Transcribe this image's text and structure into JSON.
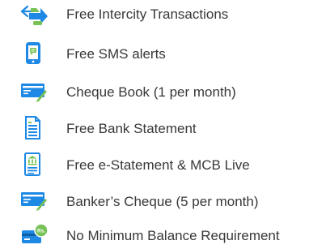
{
  "colors": {
    "primary_blue": "#1e88e5",
    "light_blue": "#6fb6ef",
    "accent_green": "#78c257",
    "text": "#383838"
  },
  "features": [
    {
      "label": "Free Intercity Transactions",
      "icon": "arrows-exchange-icon"
    },
    {
      "label": "Free SMS alerts",
      "icon": "mobile-message-icon"
    },
    {
      "label": "Cheque Book (1 per month)",
      "icon": "cheque-pen-icon"
    },
    {
      "label": "Free Bank Statement",
      "icon": "document-lines-icon"
    },
    {
      "label": "Free e-Statement & MCB Live",
      "icon": "e-statement-bank-icon"
    },
    {
      "label": "Banker’s Cheque (5 per month)",
      "icon": "bankers-cheque-icon"
    },
    {
      "label": "No Minimum Balance Requirement",
      "icon": "card-rupee-icon",
      "badge": "Rs."
    }
  ]
}
